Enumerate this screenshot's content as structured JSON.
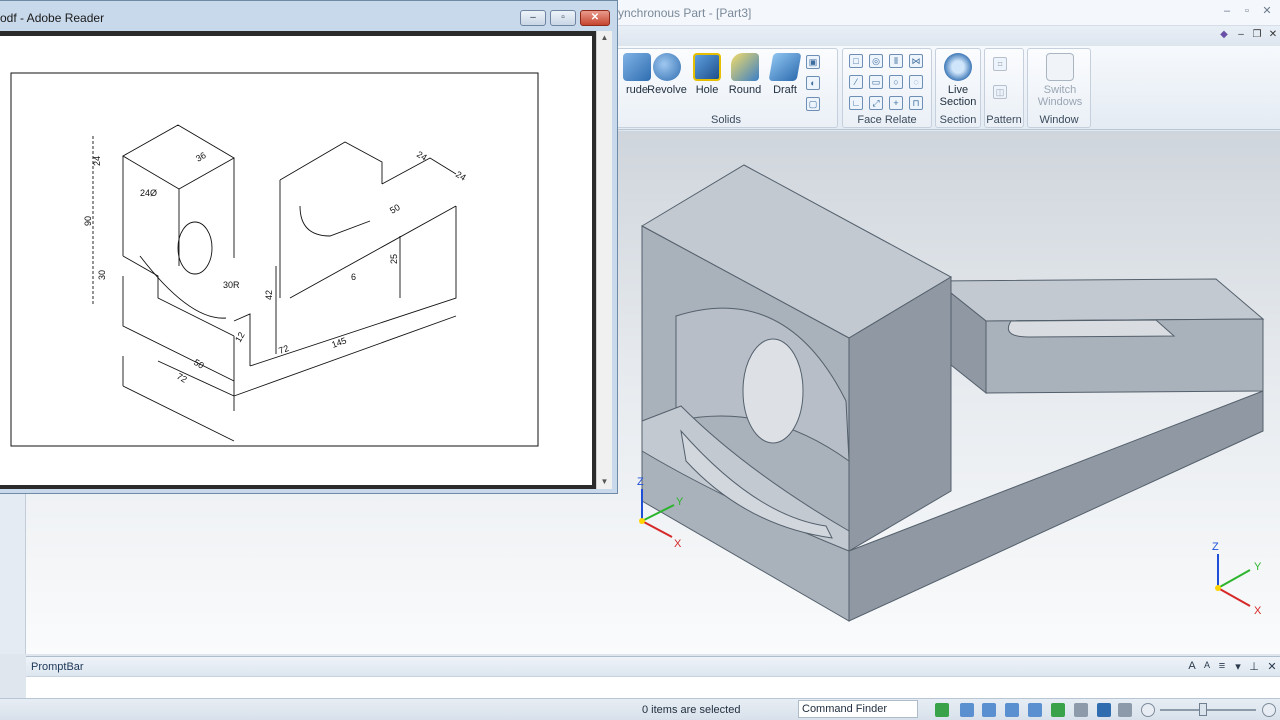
{
  "solid_edge": {
    "title": "ynchronous Part - [Part3]",
    "ribbon": {
      "solids": {
        "label": "Solids",
        "buttons": [
          {
            "label": "rude"
          },
          {
            "label": "Revolve"
          },
          {
            "label": "Hole"
          },
          {
            "label": "Round"
          },
          {
            "label": "Draft"
          }
        ]
      },
      "face_relate": {
        "label": "Face Relate"
      },
      "section": {
        "label": "Section",
        "button_line1": "Live",
        "button_line2": "Section"
      },
      "pattern": {
        "label": "Pattern"
      },
      "window": {
        "label": "Window",
        "button_line1": "Switch",
        "button_line2": "Windows"
      }
    },
    "triad": {
      "x": "X",
      "y": "Y",
      "z": "Z"
    },
    "promptbar": {
      "title": "PromptBar"
    },
    "status": {
      "selection": "0 items are selected",
      "command_finder": "Command Finder"
    }
  },
  "reader": {
    "title": "odf - Adobe Reader",
    "drawing_labels": {
      "d24_top": "24",
      "d36": "36",
      "d24_hole": "24Ø",
      "d90": "90",
      "d30": "30",
      "d30r": "30R",
      "d12": "12",
      "d42": "42",
      "d50_base": "50",
      "d72_base": "72",
      "d72_mid": "72",
      "d145": "145",
      "d24_right1": "24",
      "d24_right2": "24",
      "d50_slot": "50",
      "d25": "25",
      "d6": "6"
    }
  },
  "colors": {
    "model_top": "#c3c9d1",
    "model_front": "#a9b1bb",
    "model_side": "#8f98a3",
    "accent_blue": "#2f6db0"
  }
}
